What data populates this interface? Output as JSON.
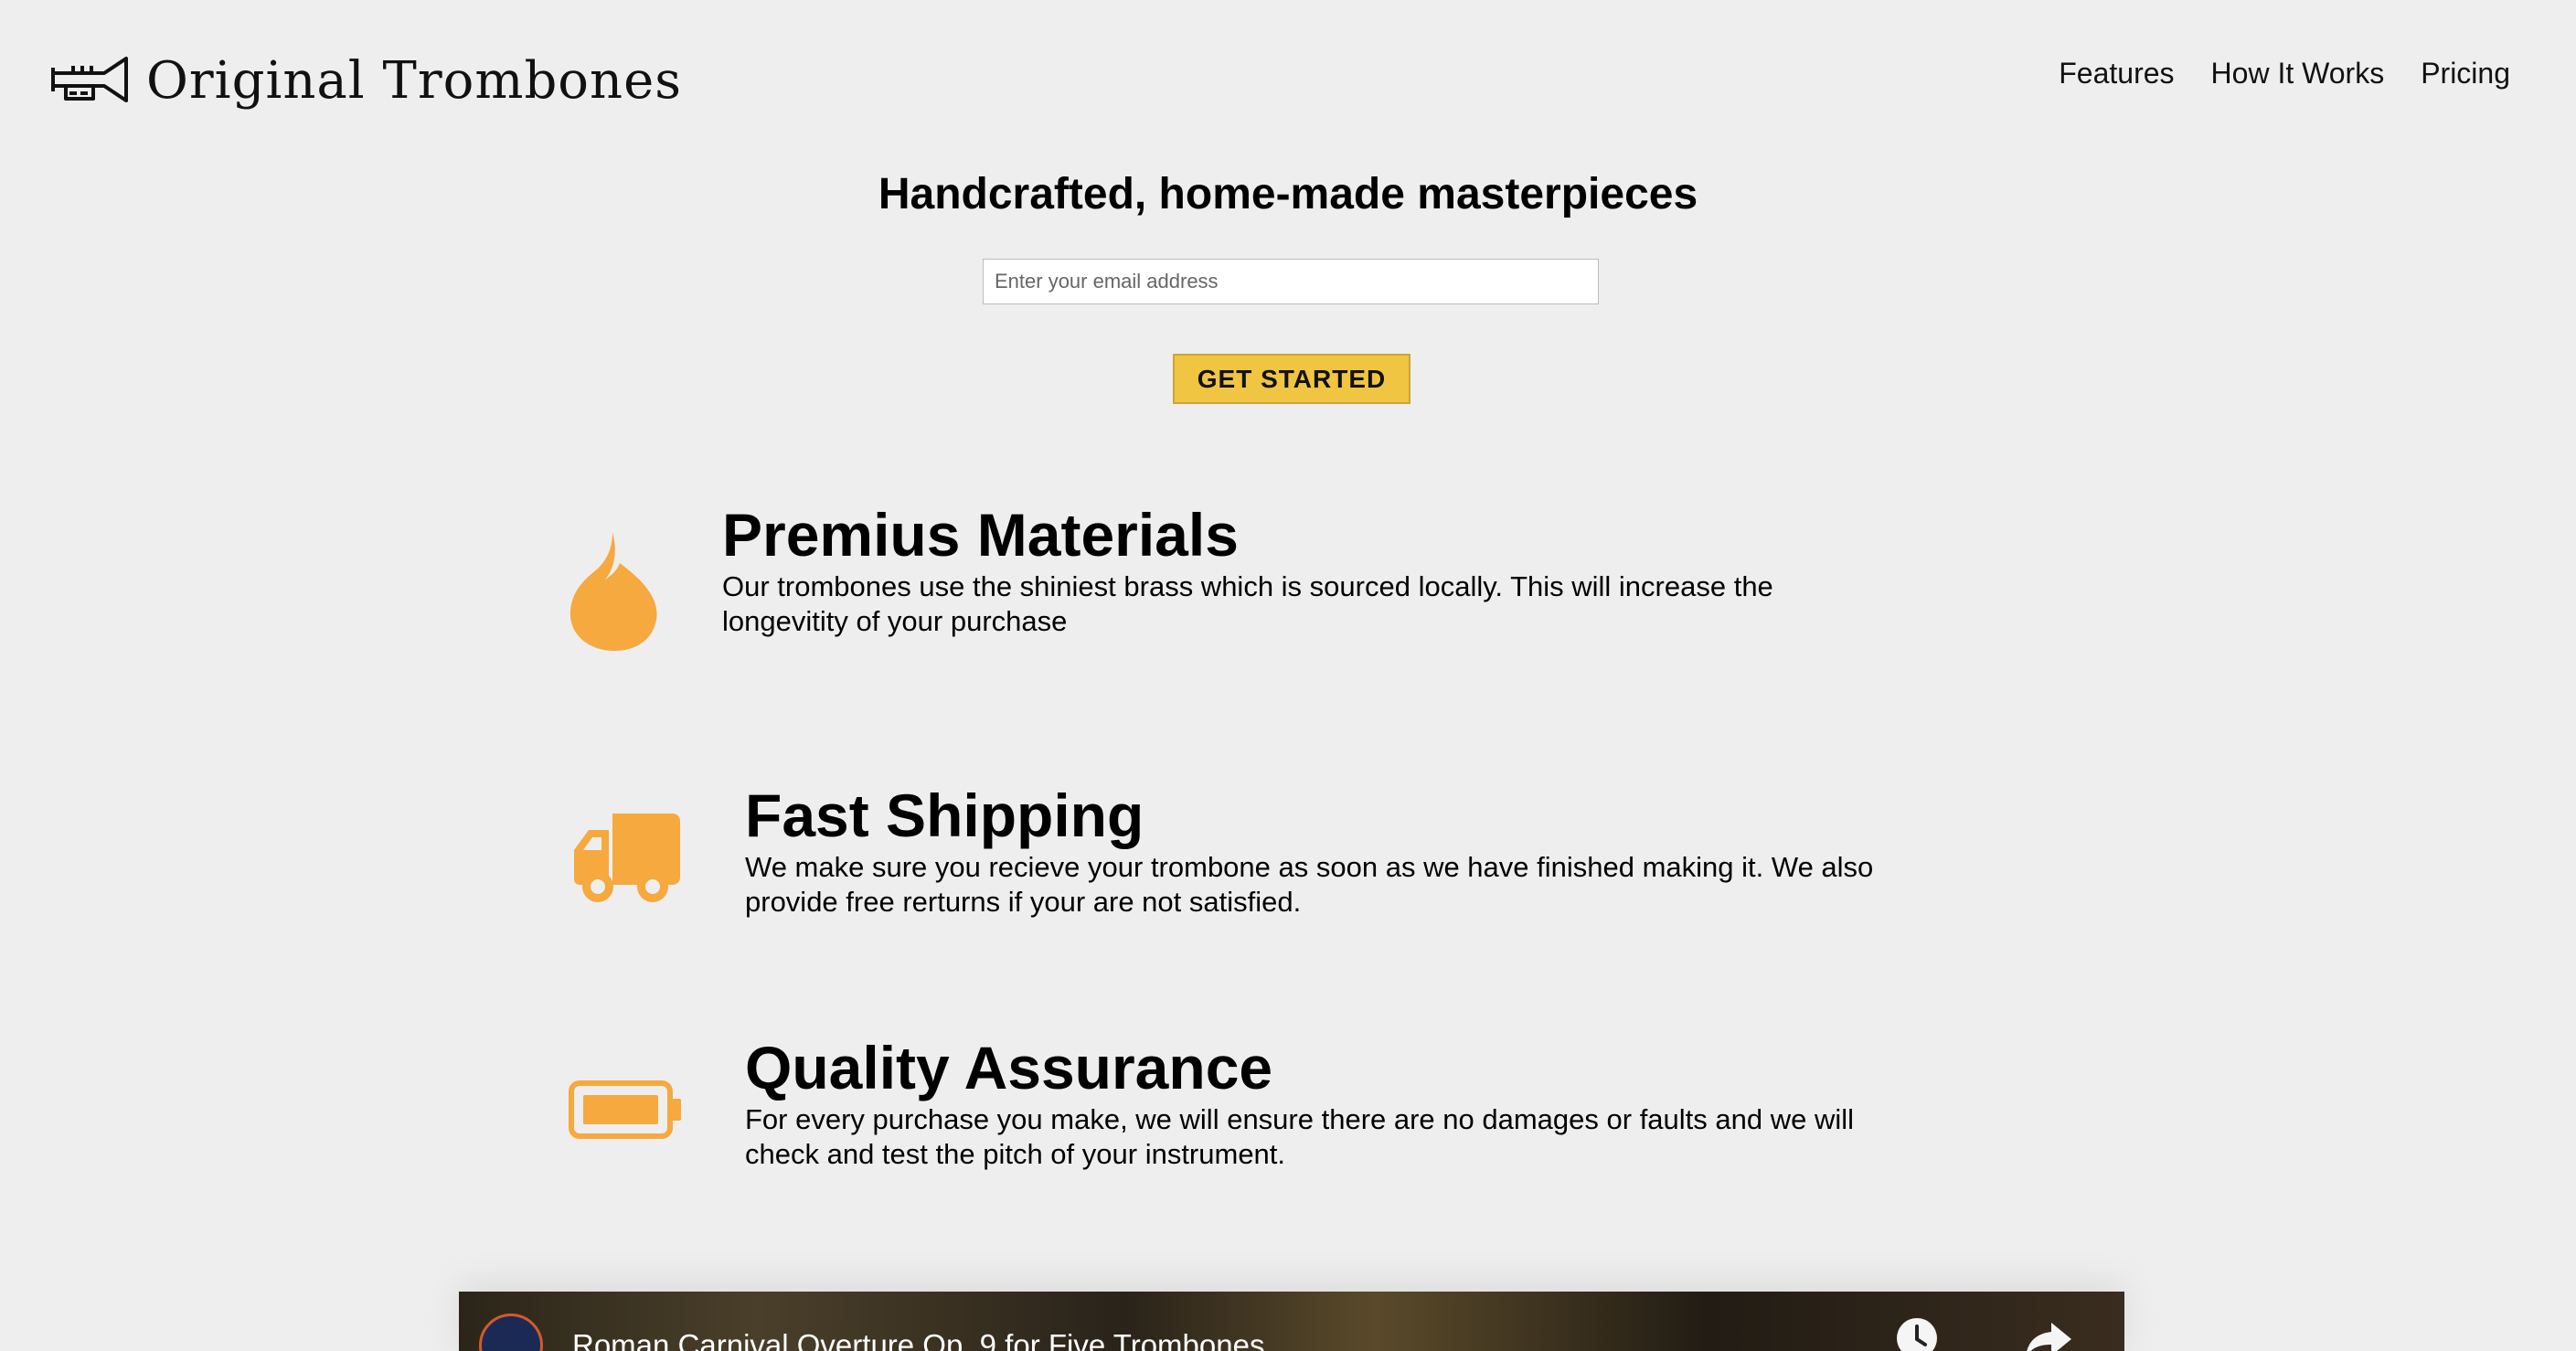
{
  "brand": {
    "name": "Original Trombones",
    "logo_icon": "trumpet-icon"
  },
  "nav": {
    "items": [
      "Features",
      "How It Works",
      "Pricing"
    ]
  },
  "hero": {
    "title": "Handcrafted, home-made masterpieces",
    "email_placeholder": "Enter your email address",
    "cta_label": "GET STARTED"
  },
  "features": [
    {
      "icon": "flame-icon",
      "title": "Premius Materials",
      "text": "Our trombones use the shiniest brass which is sourced locally. This will increase the longevitity of your purchase"
    },
    {
      "icon": "truck-icon",
      "title": "Fast Shipping",
      "text": "We make sure you recieve your trombone as soon as we have finished making it. We also provide free rerturns if your are not satisfied."
    },
    {
      "icon": "battery-icon",
      "title": "Quality Assurance",
      "text": "For every purchase you make, we will ensure there are no damages or faults and we will check and test the pitch of your instrument."
    }
  ],
  "video": {
    "title": "Roman Carnival Overture Op. 9 for Five Trombones",
    "watch_later_icon": "clock-icon",
    "share_icon": "share-icon"
  },
  "colors": {
    "background": "#eeeeee",
    "accent": "#f5a93f",
    "button": "#f0c541"
  }
}
